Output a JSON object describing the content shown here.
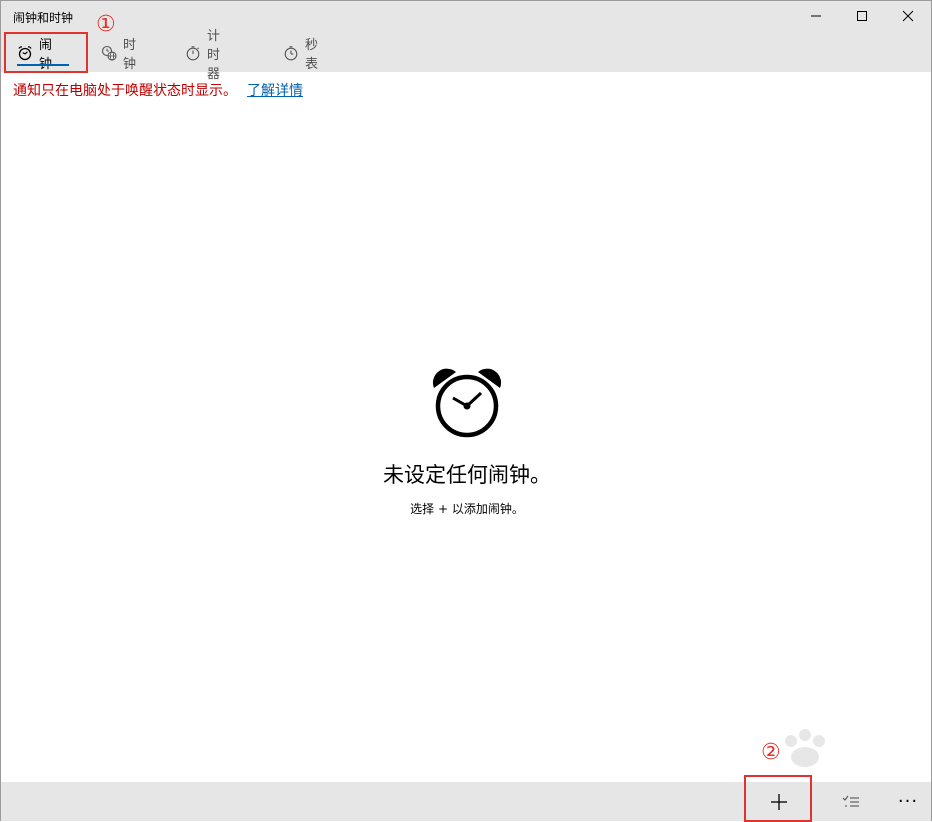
{
  "window": {
    "title": "闹钟和时钟",
    "controls": {
      "minimize": "minimize",
      "maximize": "maximize",
      "close": "close"
    }
  },
  "tabs": [
    {
      "label": "闹钟",
      "icon": "alarm-icon",
      "active": true
    },
    {
      "label": "时钟",
      "icon": "world-clock-icon",
      "active": false
    },
    {
      "label": "计时器",
      "icon": "timer-icon",
      "active": false
    },
    {
      "label": "秒表",
      "icon": "stopwatch-icon",
      "active": false
    }
  ],
  "notice": {
    "text": "通知只在电脑处于唤醒状态时显示。",
    "link": "了解详情"
  },
  "empty_state": {
    "icon": "alarm-clock-icon",
    "title": "未设定任何闹钟。",
    "subtitle": "选择 + 以添加闹钟。"
  },
  "annotations": {
    "marker_1": "①",
    "marker_2": "②",
    "color": "#e0332e"
  },
  "bottom_bar": {
    "add_icon": "plus-icon",
    "select_icon": "select-list-icon",
    "more_label": "···"
  },
  "colors": {
    "accent": "#0063b1",
    "notice": "#c00000",
    "chrome": "#e6e6e6"
  }
}
